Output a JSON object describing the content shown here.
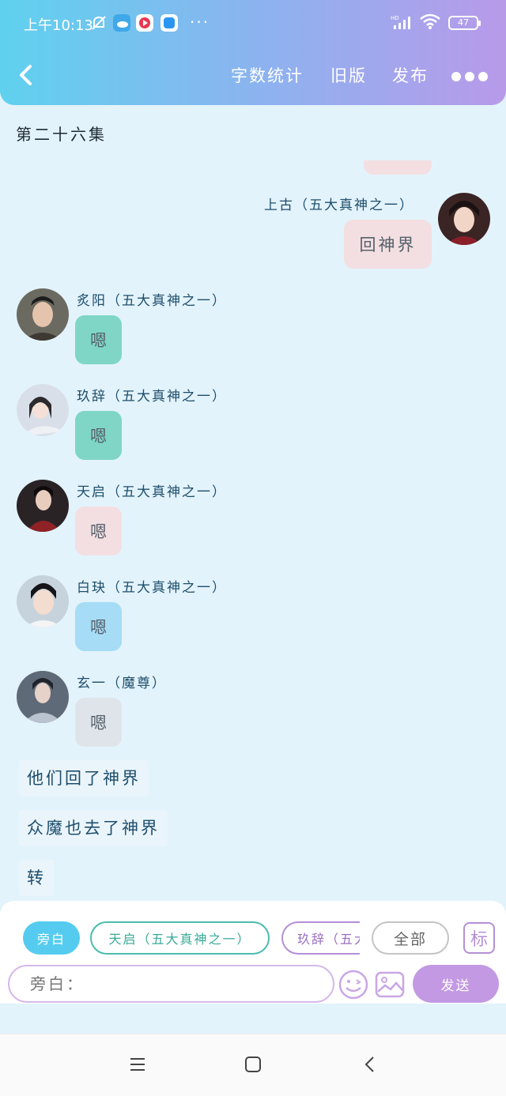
{
  "status_bar": {
    "time": "上午10:13",
    "more": "···",
    "hd": "HD",
    "battery": "47"
  },
  "header": {
    "word_count": "字数统计",
    "old_version": "旧版",
    "publish": "发布"
  },
  "episode_title": "第二十六集",
  "messages": [
    {
      "speaker": "上古（五大真神之一）",
      "text": "回神界",
      "side": "right",
      "color": "#f3dfe2"
    },
    {
      "speaker": "炙阳（五大真神之一）",
      "text": "嗯",
      "side": "left",
      "color": "#7fd6c6"
    },
    {
      "speaker": "玖辞（五大真神之一）",
      "text": "嗯",
      "side": "left",
      "color": "#7fd6c6"
    },
    {
      "speaker": "天启（五大真神之一）",
      "text": "嗯",
      "side": "left",
      "color": "#f3dfe2"
    },
    {
      "speaker": "白玦（五大真神之一）",
      "text": "嗯",
      "side": "left",
      "color": "#a6dcf5"
    },
    {
      "speaker": "玄一（魔尊）",
      "text": "嗯",
      "side": "left",
      "color": "#dfe4eb"
    }
  ],
  "narrations": [
    "他们回了神界",
    "众魔也去了神界",
    "转"
  ],
  "role_chips": {
    "narration": "旁白",
    "tianqi": "天启（五大真神之一）",
    "jiuci": "玖辞（五大真神之一）",
    "all": "全部",
    "mark": "标"
  },
  "input": {
    "placeholder": "旁白："
  },
  "send_label": "发送",
  "colors": {
    "header_start": "#5fd1ef",
    "header_end": "#b89ae9",
    "page_bg": "#e3f3fb",
    "send": "#c299e2",
    "narration_chip": "#55ccef"
  }
}
